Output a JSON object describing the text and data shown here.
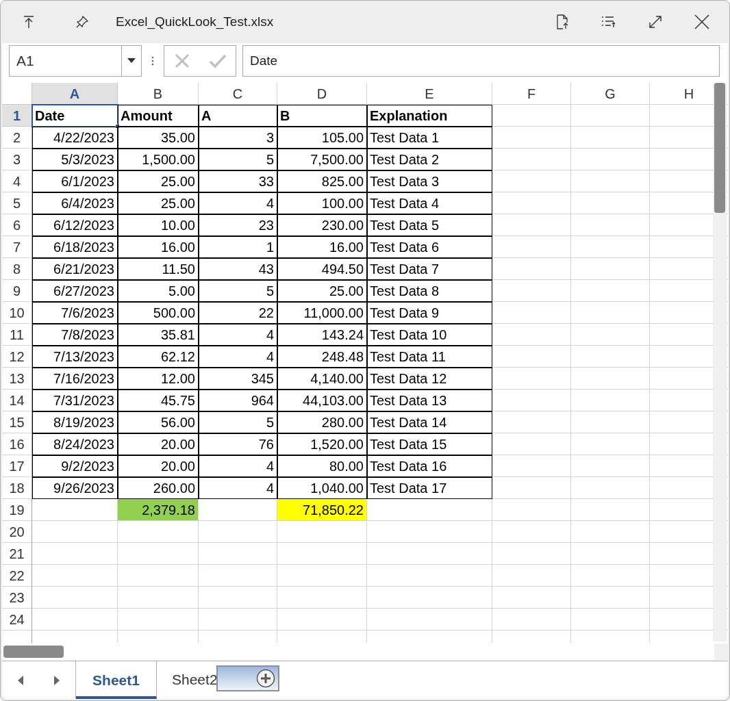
{
  "window": {
    "title": "Excel_QuickLook_Test.xlsx"
  },
  "name_box": {
    "value": "A1"
  },
  "formula_bar": {
    "value": "Date"
  },
  "sheet": {
    "columns": [
      {
        "label": "A",
        "selected": true
      },
      {
        "label": "B",
        "selected": false
      },
      {
        "label": "C",
        "selected": false
      },
      {
        "label": "D",
        "selected": false
      },
      {
        "label": "E",
        "selected": false
      },
      {
        "label": "F",
        "selected": false
      },
      {
        "label": "G",
        "selected": false
      },
      {
        "label": "H",
        "selected": false
      }
    ],
    "rows": [
      {
        "label": "1",
        "selected": true,
        "bold": true,
        "bordered": true,
        "cells": [
          {
            "text": "Date",
            "kind": "text",
            "selected": true
          },
          {
            "text": "Amount",
            "kind": "text",
            "selected": false
          },
          {
            "text": "A",
            "kind": "text",
            "selected": false
          },
          {
            "text": "B",
            "kind": "text",
            "selected": false
          },
          {
            "text": "Explanation",
            "kind": "text",
            "selected": false
          }
        ]
      },
      {
        "label": "2",
        "selected": false,
        "bold": false,
        "bordered": true,
        "cells": [
          {
            "text": "4/22/2023",
            "kind": "number",
            "selected": false
          },
          {
            "text": "35.00",
            "kind": "number",
            "selected": false
          },
          {
            "text": "3",
            "kind": "number",
            "selected": false
          },
          {
            "text": "105.00",
            "kind": "number",
            "selected": false
          },
          {
            "text": "Test Data 1",
            "kind": "text",
            "selected": false
          }
        ]
      },
      {
        "label": "3",
        "selected": false,
        "bold": false,
        "bordered": true,
        "cells": [
          {
            "text": "5/3/2023",
            "kind": "number",
            "selected": false
          },
          {
            "text": "1,500.00",
            "kind": "number",
            "selected": false
          },
          {
            "text": "5",
            "kind": "number",
            "selected": false
          },
          {
            "text": "7,500.00",
            "kind": "number",
            "selected": false
          },
          {
            "text": "Test Data 2",
            "kind": "text",
            "selected": false
          }
        ]
      },
      {
        "label": "4",
        "selected": false,
        "bold": false,
        "bordered": true,
        "cells": [
          {
            "text": "6/1/2023",
            "kind": "number",
            "selected": false
          },
          {
            "text": "25.00",
            "kind": "number",
            "selected": false
          },
          {
            "text": "33",
            "kind": "number",
            "selected": false
          },
          {
            "text": "825.00",
            "kind": "number",
            "selected": false
          },
          {
            "text": "Test Data 3",
            "kind": "text",
            "selected": false
          }
        ]
      },
      {
        "label": "5",
        "selected": false,
        "bold": false,
        "bordered": true,
        "cells": [
          {
            "text": "6/4/2023",
            "kind": "number",
            "selected": false
          },
          {
            "text": "25.00",
            "kind": "number",
            "selected": false
          },
          {
            "text": "4",
            "kind": "number",
            "selected": false
          },
          {
            "text": "100.00",
            "kind": "number",
            "selected": false
          },
          {
            "text": "Test Data 4",
            "kind": "text",
            "selected": false
          }
        ]
      },
      {
        "label": "6",
        "selected": false,
        "bold": false,
        "bordered": true,
        "cells": [
          {
            "text": "6/12/2023",
            "kind": "number",
            "selected": false
          },
          {
            "text": "10.00",
            "kind": "number",
            "selected": false
          },
          {
            "text": "23",
            "kind": "number",
            "selected": false
          },
          {
            "text": "230.00",
            "kind": "number",
            "selected": false
          },
          {
            "text": "Test Data 5",
            "kind": "text",
            "selected": false
          }
        ]
      },
      {
        "label": "7",
        "selected": false,
        "bold": false,
        "bordered": true,
        "cells": [
          {
            "text": "6/18/2023",
            "kind": "number",
            "selected": false
          },
          {
            "text": "16.00",
            "kind": "number",
            "selected": false
          },
          {
            "text": "1",
            "kind": "number",
            "selected": false
          },
          {
            "text": "16.00",
            "kind": "number",
            "selected": false
          },
          {
            "text": "Test Data 6",
            "kind": "text",
            "selected": false
          }
        ]
      },
      {
        "label": "8",
        "selected": false,
        "bold": false,
        "bordered": true,
        "cells": [
          {
            "text": "6/21/2023",
            "kind": "number",
            "selected": false
          },
          {
            "text": "11.50",
            "kind": "number",
            "selected": false
          },
          {
            "text": "43",
            "kind": "number",
            "selected": false
          },
          {
            "text": "494.50",
            "kind": "number",
            "selected": false
          },
          {
            "text": "Test Data 7",
            "kind": "text",
            "selected": false
          }
        ]
      },
      {
        "label": "9",
        "selected": false,
        "bold": false,
        "bordered": true,
        "cells": [
          {
            "text": "6/27/2023",
            "kind": "number",
            "selected": false
          },
          {
            "text": "5.00",
            "kind": "number",
            "selected": false
          },
          {
            "text": "5",
            "kind": "number",
            "selected": false
          },
          {
            "text": "25.00",
            "kind": "number",
            "selected": false
          },
          {
            "text": "Test Data 8",
            "kind": "text",
            "selected": false
          }
        ]
      },
      {
        "label": "10",
        "selected": false,
        "bold": false,
        "bordered": true,
        "cells": [
          {
            "text": "7/6/2023",
            "kind": "number",
            "selected": false
          },
          {
            "text": "500.00",
            "kind": "number",
            "selected": false
          },
          {
            "text": "22",
            "kind": "number",
            "selected": false
          },
          {
            "text": "11,000.00",
            "kind": "number",
            "selected": false
          },
          {
            "text": "Test Data 9",
            "kind": "text",
            "selected": false
          }
        ]
      },
      {
        "label": "11",
        "selected": false,
        "bold": false,
        "bordered": true,
        "cells": [
          {
            "text": "7/8/2023",
            "kind": "number",
            "selected": false
          },
          {
            "text": "35.81",
            "kind": "number",
            "selected": false
          },
          {
            "text": "4",
            "kind": "number",
            "selected": false
          },
          {
            "text": "143.24",
            "kind": "number",
            "selected": false
          },
          {
            "text": "Test Data 10",
            "kind": "text",
            "selected": false
          }
        ]
      },
      {
        "label": "12",
        "selected": false,
        "bold": false,
        "bordered": true,
        "cells": [
          {
            "text": "7/13/2023",
            "kind": "number",
            "selected": false
          },
          {
            "text": "62.12",
            "kind": "number",
            "selected": false
          },
          {
            "text": "4",
            "kind": "number",
            "selected": false
          },
          {
            "text": "248.48",
            "kind": "number",
            "selected": false
          },
          {
            "text": "Test Data 11",
            "kind": "text",
            "selected": false
          }
        ]
      },
      {
        "label": "13",
        "selected": false,
        "bold": false,
        "bordered": true,
        "cells": [
          {
            "text": "7/16/2023",
            "kind": "number",
            "selected": false
          },
          {
            "text": "12.00",
            "kind": "number",
            "selected": false
          },
          {
            "text": "345",
            "kind": "number",
            "selected": false
          },
          {
            "text": "4,140.00",
            "kind": "number",
            "selected": false
          },
          {
            "text": "Test Data 12",
            "kind": "text",
            "selected": false
          }
        ]
      },
      {
        "label": "14",
        "selected": false,
        "bold": false,
        "bordered": true,
        "cells": [
          {
            "text": "7/31/2023",
            "kind": "number",
            "selected": false
          },
          {
            "text": "45.75",
            "kind": "number",
            "selected": false
          },
          {
            "text": "964",
            "kind": "number",
            "selected": false
          },
          {
            "text": "44,103.00",
            "kind": "number",
            "selected": false
          },
          {
            "text": "Test Data 13",
            "kind": "text",
            "selected": false
          }
        ]
      },
      {
        "label": "15",
        "selected": false,
        "bold": false,
        "bordered": true,
        "cells": [
          {
            "text": "8/19/2023",
            "kind": "number",
            "selected": false
          },
          {
            "text": "56.00",
            "kind": "number",
            "selected": false
          },
          {
            "text": "5",
            "kind": "number",
            "selected": false
          },
          {
            "text": "280.00",
            "kind": "number",
            "selected": false
          },
          {
            "text": "Test Data 14",
            "kind": "text",
            "selected": false
          }
        ]
      },
      {
        "label": "16",
        "selected": false,
        "bold": false,
        "bordered": true,
        "cells": [
          {
            "text": "8/24/2023",
            "kind": "number",
            "selected": false
          },
          {
            "text": "20.00",
            "kind": "number",
            "selected": false
          },
          {
            "text": "76",
            "kind": "number",
            "selected": false
          },
          {
            "text": "1,520.00",
            "kind": "number",
            "selected": false
          },
          {
            "text": "Test Data 15",
            "kind": "text",
            "selected": false
          }
        ]
      },
      {
        "label": "17",
        "selected": false,
        "bold": false,
        "bordered": true,
        "cells": [
          {
            "text": "9/2/2023",
            "kind": "number",
            "selected": false
          },
          {
            "text": "20.00",
            "kind": "number",
            "selected": false
          },
          {
            "text": "4",
            "kind": "number",
            "selected": false
          },
          {
            "text": "80.00",
            "kind": "number",
            "selected": false
          },
          {
            "text": "Test Data 16",
            "kind": "text",
            "selected": false
          }
        ]
      },
      {
        "label": "18",
        "selected": false,
        "bold": false,
        "bordered": true,
        "cells": [
          {
            "text": "9/26/2023",
            "kind": "number",
            "selected": false
          },
          {
            "text": "260.00",
            "kind": "number",
            "selected": false
          },
          {
            "text": "4",
            "kind": "number",
            "selected": false
          },
          {
            "text": "1,040.00",
            "kind": "number",
            "selected": false
          },
          {
            "text": "Test Data 17",
            "kind": "text",
            "selected": false
          }
        ]
      },
      {
        "label": "19",
        "selected": false,
        "cells": [
          {
            "text": ""
          },
          {
            "text": "2,379.18",
            "kind": "number",
            "selected": false,
            "color": "#92d050"
          },
          {
            "text": ""
          },
          {
            "text": "71,850.22",
            "kind": "number",
            "selected": false,
            "color": "#ffff00"
          }
        ]
      },
      {
        "label": "20",
        "selected": false,
        "cells": []
      },
      {
        "label": "21",
        "selected": false,
        "cells": []
      },
      {
        "label": "22",
        "selected": false,
        "cells": []
      },
      {
        "label": "23",
        "selected": false,
        "cells": []
      },
      {
        "label": "24",
        "selected": false,
        "cells": []
      }
    ]
  },
  "sheet_tabs": [
    {
      "label": "Sheet1",
      "selected": true
    },
    {
      "label": "Sheet2",
      "selected": false
    }
  ]
}
